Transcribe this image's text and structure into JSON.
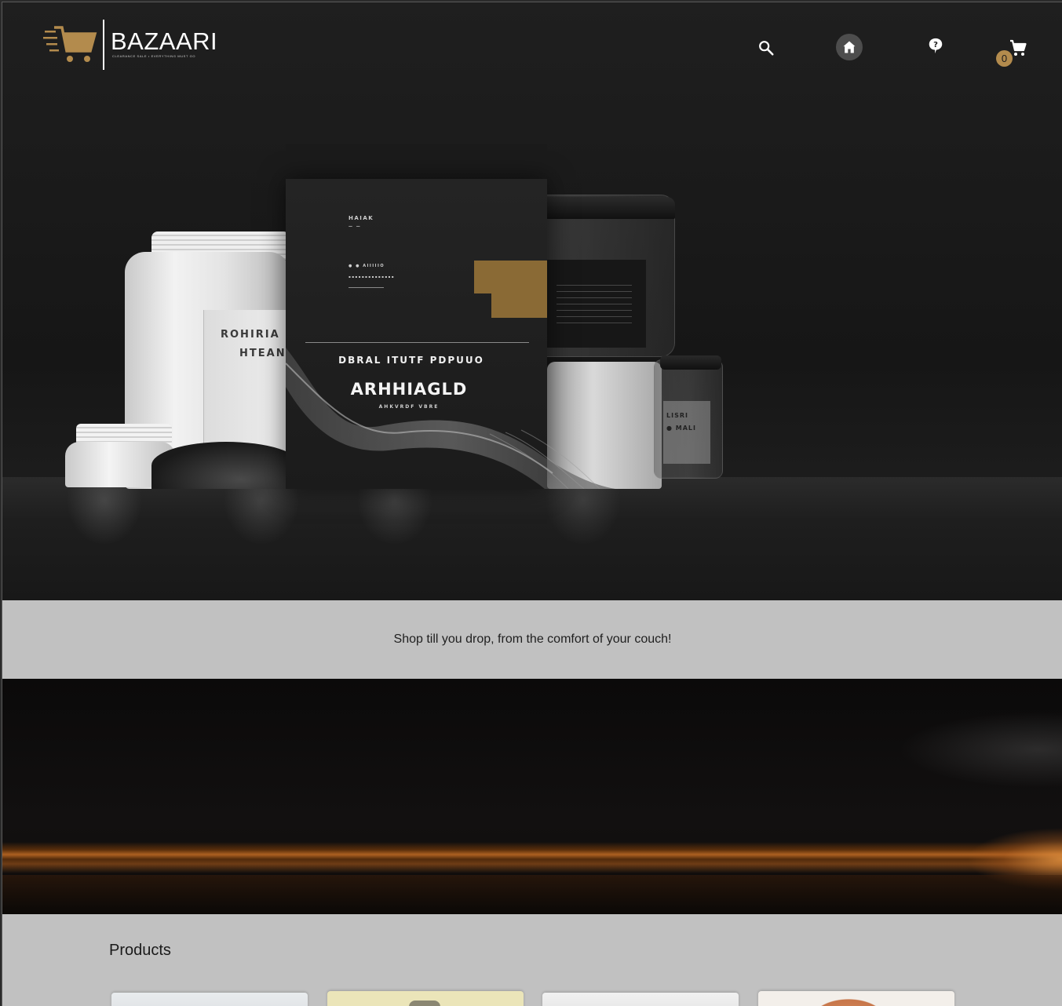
{
  "brand": {
    "name": "BAZAARI",
    "tagline": "CLEARANCE SALE • EVERYTHING MUST GO",
    "accent_color": "#b38b4d"
  },
  "nav": {
    "search_icon": "search-icon",
    "home_icon": "home-icon",
    "help_icon": "help-icon",
    "cart_icon": "cart-icon",
    "cart_count": "0"
  },
  "hero": {
    "jar_text_1": "ROHIRIA",
    "jar_text_2": "HTEAN",
    "package": {
      "label_top": "HAIAK",
      "label_top_sub": "—  —",
      "label_mid": "● ●  AIIIIIO",
      "label_mid_sub": "▪▪▪▪▪▪▪▪▪▪▪▪▪▪",
      "headline": "DBRAL ITUTF PDPUUO",
      "brand": "ARHHIAGLD",
      "sub": "AHKVRDF VBRE"
    },
    "right_jar_text_1": "LISRI",
    "right_jar_text_2": "● MALI"
  },
  "tagline_band": {
    "text": "Shop till you drop, from the comfort of your couch!"
  },
  "products": {
    "title": "Products"
  }
}
